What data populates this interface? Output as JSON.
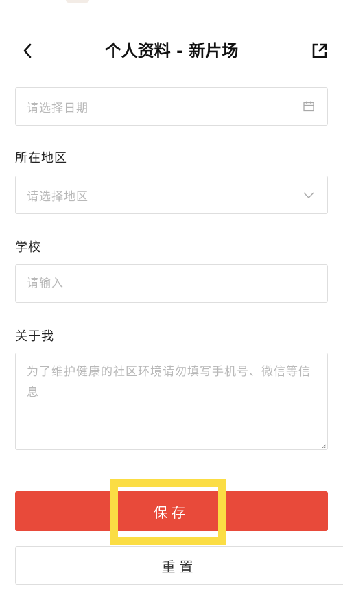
{
  "header": {
    "title": "个人资料 - 新片场"
  },
  "form": {
    "date": {
      "placeholder": "请选择日期"
    },
    "region": {
      "label": "所在地区",
      "placeholder": "请选择地区"
    },
    "school": {
      "label": "学校",
      "placeholder": "请输入"
    },
    "about": {
      "label": "关于我",
      "placeholder": "为了维护健康的社区环境请勿填写手机号、微信等信息"
    }
  },
  "actions": {
    "save_label": "保存",
    "reset_label": "重置"
  },
  "colors": {
    "save_button": "#e84a3a",
    "highlight_frame": "#fbdd44",
    "placeholder": "#b8b8b8",
    "border": "#dedede"
  },
  "icons": {
    "back": "chevron-left-icon",
    "share": "external-link-icon",
    "date": "calendar-icon",
    "region": "chevron-down-icon"
  }
}
